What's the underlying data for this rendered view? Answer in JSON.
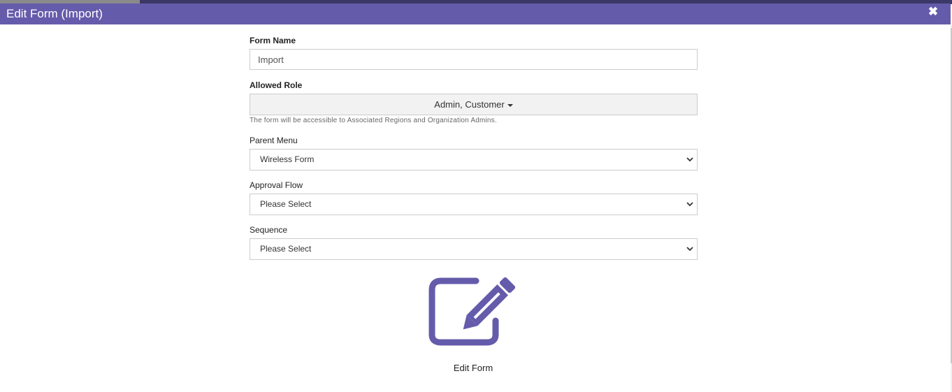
{
  "modal": {
    "title": "Edit Form (Import)",
    "close_icon": "close-icon",
    "close_glyph": "✖"
  },
  "form": {
    "form_name": {
      "label": "Form Name",
      "value": "Import"
    },
    "allowed_role": {
      "label": "Allowed Role",
      "value": "Admin, Customer",
      "help": "The form will be accessible to Associated Regions and Organization Admins."
    },
    "parent_menu": {
      "label": "Parent Menu",
      "value": "Wireless Form"
    },
    "approval_flow": {
      "label": "Approval Flow",
      "value": "Please Select"
    },
    "sequence": {
      "label": "Sequence",
      "value": "Please Select"
    }
  },
  "edit_action": {
    "icon": "edit-pencil-icon",
    "label": "Edit Form"
  },
  "colors": {
    "header": "#655bab",
    "accent": "#655bab"
  }
}
